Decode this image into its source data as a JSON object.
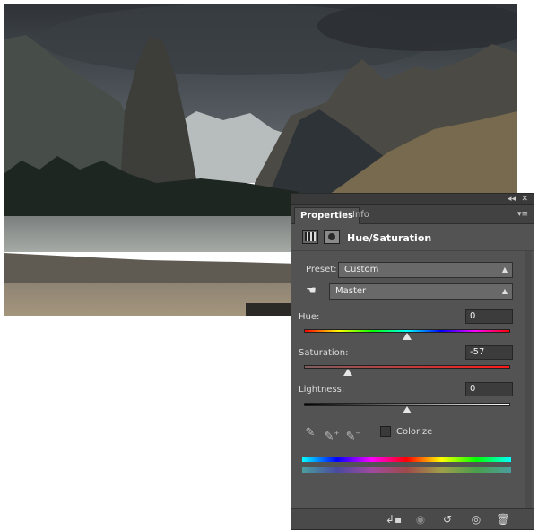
{
  "panel": {
    "tabs": [
      {
        "label": "Properties",
        "active": true
      },
      {
        "label": "Info",
        "active": false
      }
    ],
    "collapse_glyph": "◂◂",
    "close_glyph": "✕",
    "menu_glyph": "▾≡",
    "title": "Hue/Saturation",
    "preset": {
      "label": "Preset:",
      "value": "Custom"
    },
    "channel": {
      "value": "Master"
    },
    "hue": {
      "label": "Hue:",
      "value": "0",
      "level": 0.5
    },
    "saturation": {
      "label": "Saturation:",
      "value": "-57",
      "level": 0.215
    },
    "lightness": {
      "label": "Lightness:",
      "value": "0",
      "level": 0.5
    },
    "colorize": {
      "label": "Colorize",
      "checked": false
    },
    "icons": {
      "adjustment": "hue-saturation-layer-icon",
      "mask": "layer-mask-icon",
      "hand": "on-image-adjust-hand-icon",
      "eyedropper": "eyedropper-icon",
      "eyedropper_plus": "eyedropper-add-icon",
      "eyedropper_minus": "eyedropper-subtract-icon",
      "clip": "clip-to-layer-icon",
      "view_previous": "view-previous-state-icon",
      "reset": "reset-icon",
      "visibility": "eye-icon",
      "delete": "trash-icon"
    },
    "colors": {
      "panel_bg": "#535353",
      "field_bg": "#3c3c3c",
      "dropdown_bg": "#696969",
      "text": "#dcdcdc"
    }
  }
}
